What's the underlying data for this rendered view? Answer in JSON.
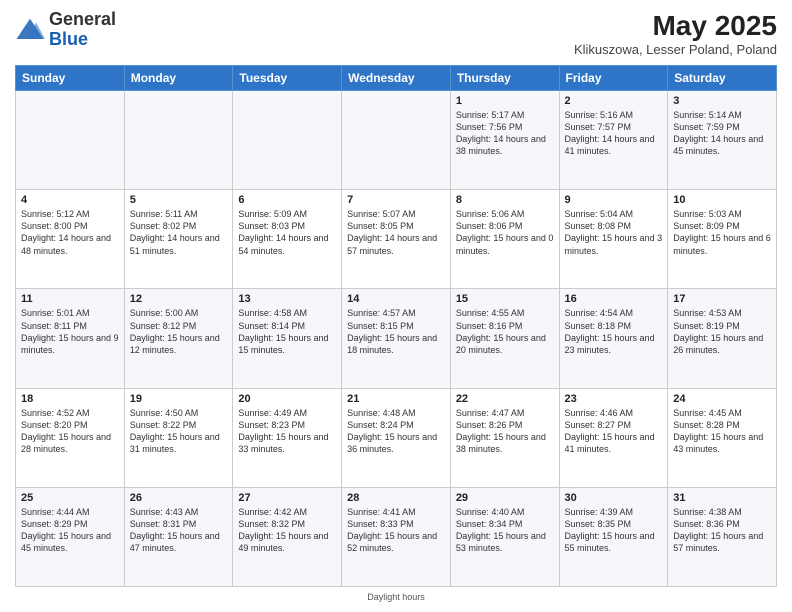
{
  "logo": {
    "text_general": "General",
    "text_blue": "Blue"
  },
  "header": {
    "title": "May 2025",
    "subtitle": "Klikuszowa, Lesser Poland, Poland"
  },
  "weekdays": [
    "Sunday",
    "Monday",
    "Tuesday",
    "Wednesday",
    "Thursday",
    "Friday",
    "Saturday"
  ],
  "weeks": [
    [
      {
        "day": "",
        "info": ""
      },
      {
        "day": "",
        "info": ""
      },
      {
        "day": "",
        "info": ""
      },
      {
        "day": "",
        "info": ""
      },
      {
        "day": "1",
        "info": "Sunrise: 5:17 AM\nSunset: 7:56 PM\nDaylight: 14 hours and 38 minutes."
      },
      {
        "day": "2",
        "info": "Sunrise: 5:16 AM\nSunset: 7:57 PM\nDaylight: 14 hours and 41 minutes."
      },
      {
        "day": "3",
        "info": "Sunrise: 5:14 AM\nSunset: 7:59 PM\nDaylight: 14 hours and 45 minutes."
      }
    ],
    [
      {
        "day": "4",
        "info": "Sunrise: 5:12 AM\nSunset: 8:00 PM\nDaylight: 14 hours and 48 minutes."
      },
      {
        "day": "5",
        "info": "Sunrise: 5:11 AM\nSunset: 8:02 PM\nDaylight: 14 hours and 51 minutes."
      },
      {
        "day": "6",
        "info": "Sunrise: 5:09 AM\nSunset: 8:03 PM\nDaylight: 14 hours and 54 minutes."
      },
      {
        "day": "7",
        "info": "Sunrise: 5:07 AM\nSunset: 8:05 PM\nDaylight: 14 hours and 57 minutes."
      },
      {
        "day": "8",
        "info": "Sunrise: 5:06 AM\nSunset: 8:06 PM\nDaylight: 15 hours and 0 minutes."
      },
      {
        "day": "9",
        "info": "Sunrise: 5:04 AM\nSunset: 8:08 PM\nDaylight: 15 hours and 3 minutes."
      },
      {
        "day": "10",
        "info": "Sunrise: 5:03 AM\nSunset: 8:09 PM\nDaylight: 15 hours and 6 minutes."
      }
    ],
    [
      {
        "day": "11",
        "info": "Sunrise: 5:01 AM\nSunset: 8:11 PM\nDaylight: 15 hours and 9 minutes."
      },
      {
        "day": "12",
        "info": "Sunrise: 5:00 AM\nSunset: 8:12 PM\nDaylight: 15 hours and 12 minutes."
      },
      {
        "day": "13",
        "info": "Sunrise: 4:58 AM\nSunset: 8:14 PM\nDaylight: 15 hours and 15 minutes."
      },
      {
        "day": "14",
        "info": "Sunrise: 4:57 AM\nSunset: 8:15 PM\nDaylight: 15 hours and 18 minutes."
      },
      {
        "day": "15",
        "info": "Sunrise: 4:55 AM\nSunset: 8:16 PM\nDaylight: 15 hours and 20 minutes."
      },
      {
        "day": "16",
        "info": "Sunrise: 4:54 AM\nSunset: 8:18 PM\nDaylight: 15 hours and 23 minutes."
      },
      {
        "day": "17",
        "info": "Sunrise: 4:53 AM\nSunset: 8:19 PM\nDaylight: 15 hours and 26 minutes."
      }
    ],
    [
      {
        "day": "18",
        "info": "Sunrise: 4:52 AM\nSunset: 8:20 PM\nDaylight: 15 hours and 28 minutes."
      },
      {
        "day": "19",
        "info": "Sunrise: 4:50 AM\nSunset: 8:22 PM\nDaylight: 15 hours and 31 minutes."
      },
      {
        "day": "20",
        "info": "Sunrise: 4:49 AM\nSunset: 8:23 PM\nDaylight: 15 hours and 33 minutes."
      },
      {
        "day": "21",
        "info": "Sunrise: 4:48 AM\nSunset: 8:24 PM\nDaylight: 15 hours and 36 minutes."
      },
      {
        "day": "22",
        "info": "Sunrise: 4:47 AM\nSunset: 8:26 PM\nDaylight: 15 hours and 38 minutes."
      },
      {
        "day": "23",
        "info": "Sunrise: 4:46 AM\nSunset: 8:27 PM\nDaylight: 15 hours and 41 minutes."
      },
      {
        "day": "24",
        "info": "Sunrise: 4:45 AM\nSunset: 8:28 PM\nDaylight: 15 hours and 43 minutes."
      }
    ],
    [
      {
        "day": "25",
        "info": "Sunrise: 4:44 AM\nSunset: 8:29 PM\nDaylight: 15 hours and 45 minutes."
      },
      {
        "day": "26",
        "info": "Sunrise: 4:43 AM\nSunset: 8:31 PM\nDaylight: 15 hours and 47 minutes."
      },
      {
        "day": "27",
        "info": "Sunrise: 4:42 AM\nSunset: 8:32 PM\nDaylight: 15 hours and 49 minutes."
      },
      {
        "day": "28",
        "info": "Sunrise: 4:41 AM\nSunset: 8:33 PM\nDaylight: 15 hours and 52 minutes."
      },
      {
        "day": "29",
        "info": "Sunrise: 4:40 AM\nSunset: 8:34 PM\nDaylight: 15 hours and 53 minutes."
      },
      {
        "day": "30",
        "info": "Sunrise: 4:39 AM\nSunset: 8:35 PM\nDaylight: 15 hours and 55 minutes."
      },
      {
        "day": "31",
        "info": "Sunrise: 4:38 AM\nSunset: 8:36 PM\nDaylight: 15 hours and 57 minutes."
      }
    ]
  ],
  "footer_note": "Daylight hours"
}
